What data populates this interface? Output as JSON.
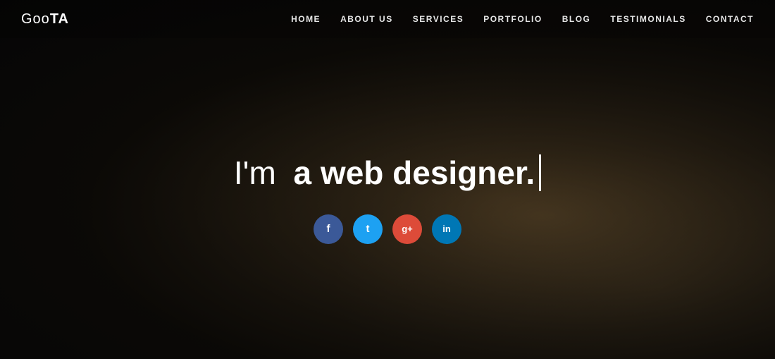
{
  "site": {
    "logo": "GooTA",
    "logo_normal": "Goo",
    "logo_bold": "TA"
  },
  "nav": {
    "items": [
      {
        "label": "HOME",
        "active": false
      },
      {
        "label": "ABOUT US",
        "active": true
      },
      {
        "label": "SERVICES",
        "active": false
      },
      {
        "label": "PORTFOLIO",
        "active": false
      },
      {
        "label": "BLOG",
        "active": false
      },
      {
        "label": "TESTIMONIALS",
        "active": false
      },
      {
        "label": "CONTACT",
        "active": false
      }
    ]
  },
  "hero": {
    "tagline_light": "I'm",
    "tagline_bold": "a web designer."
  },
  "social": {
    "icons": [
      {
        "name": "facebook",
        "label": "f",
        "class": "facebook",
        "title": "Facebook"
      },
      {
        "name": "twitter",
        "label": "t",
        "class": "twitter",
        "title": "Twitter"
      },
      {
        "name": "googleplus",
        "label": "g+",
        "class": "google",
        "title": "Google Plus"
      },
      {
        "name": "linkedin",
        "label": "in",
        "class": "linkedin",
        "title": "LinkedIn"
      }
    ]
  },
  "colors": {
    "facebook": "#3b5998",
    "twitter": "#1da1f2",
    "google": "#dd4b39",
    "linkedin": "#0077b5",
    "background": "#111111",
    "text": "#ffffff"
  }
}
